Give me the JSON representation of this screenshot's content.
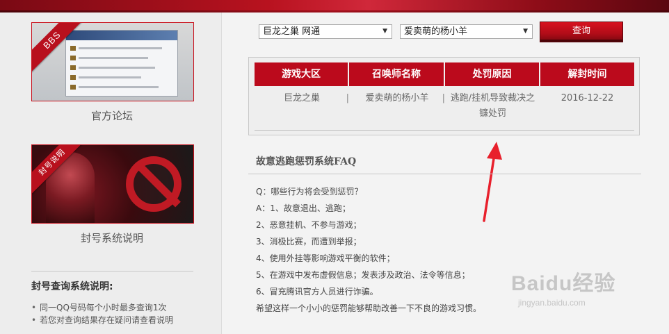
{
  "search": {
    "region_value": "巨龙之巢 网通",
    "summoner_value": "爱卖萌的杨小羊",
    "query_label": "查询"
  },
  "sidebar": {
    "forum": {
      "badge": "BBS",
      "caption": "官方论坛"
    },
    "ban": {
      "badge": "封号说明",
      "caption": "封号系统说明"
    },
    "notes_title": "封号查询系统说明:",
    "notes": [
      "同一QQ号码每个小时最多查询1次",
      "若您对查询结果存在疑问请查看说明"
    ]
  },
  "result_table": {
    "headers": [
      "游戏大区",
      "召唤师名称",
      "处罚原因",
      "解封时间"
    ],
    "row": {
      "region": "巨龙之巢",
      "summoner": "爱卖萌的杨小羊",
      "reason": "逃跑/挂机导致裁决之镰处罚",
      "unban_time": "2016-12-22"
    }
  },
  "faq": {
    "title": "故意逃跑惩罚系统FAQ",
    "lines": [
      "Q：哪些行为将会受到惩罚？",
      "A：1、故意退出、逃跑；",
      "2、恶意挂机、不参与游戏；",
      "3、消极比赛，而遭到举报；",
      "4、使用外挂等影响游戏平衡的软件；",
      "5、在游戏中发布虚假信息；发表涉及政治、法令等信息；",
      "6、冒充腾讯官方人员进行诈骗。",
      "希望这样一个小小的惩罚能够帮助改善一下不良的游戏习惯。"
    ]
  },
  "watermark": {
    "brand": "Baidu经验",
    "url": "jingyan.baidu.com"
  },
  "colors": {
    "accent": "#bb0a1c",
    "button": "#c00c18"
  }
}
